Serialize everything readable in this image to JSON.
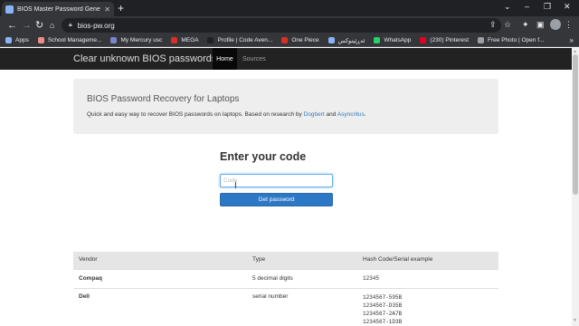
{
  "browser": {
    "tab_title": "BIOS Master Password Generator",
    "url": "bios-pw.org",
    "bookmarks": [
      {
        "label": "Apps",
        "color": "#8ab4f8"
      },
      {
        "label": "School Manageme...",
        "color": "#f28b82"
      },
      {
        "label": "My Mercury usc",
        "color": "#7986cb"
      },
      {
        "label": "MEGA",
        "color": "#d93025"
      },
      {
        "label": "Profile | Code Aven...",
        "color": "#202124"
      },
      {
        "label": "One Piece",
        "color": "#d93025"
      },
      {
        "label": "ئەڕێینوکس",
        "color": "#8ab4f8"
      },
      {
        "label": "WhatsApp",
        "color": "#25d366"
      },
      {
        "label": "(230) Pinterest",
        "color": "#e60023"
      },
      {
        "label": "Free Photo | Open f...",
        "color": "#9aa0a6"
      }
    ]
  },
  "site": {
    "brand": "Clear unknown BIOS passwords",
    "nav_home": "Home",
    "nav_sources": "Sources"
  },
  "jumbotron": {
    "title": "BIOS Password Recovery for Laptops",
    "text_prefix": "Quick and easy way to recover BIOS passwords on laptops. Based on research by ",
    "link1": "Dogbert",
    "text_and": " and ",
    "link2": "Asyncritus",
    "text_suffix": "."
  },
  "form": {
    "title": "Enter your code",
    "placeholder": "Code",
    "button": "Get password"
  },
  "table": {
    "headers": [
      "Vendor",
      "Type",
      "Hash Code/Serial example"
    ],
    "rows": [
      {
        "vendor": "Compaq",
        "type": "5 decimal digits",
        "examples": [
          "12345"
        ]
      },
      {
        "vendor": "Dell",
        "type": "serial number",
        "examples": [
          "1234567-595B",
          "1234567-D35B",
          "1234567-2A7B",
          "1234567-1D3B"
        ]
      }
    ]
  }
}
